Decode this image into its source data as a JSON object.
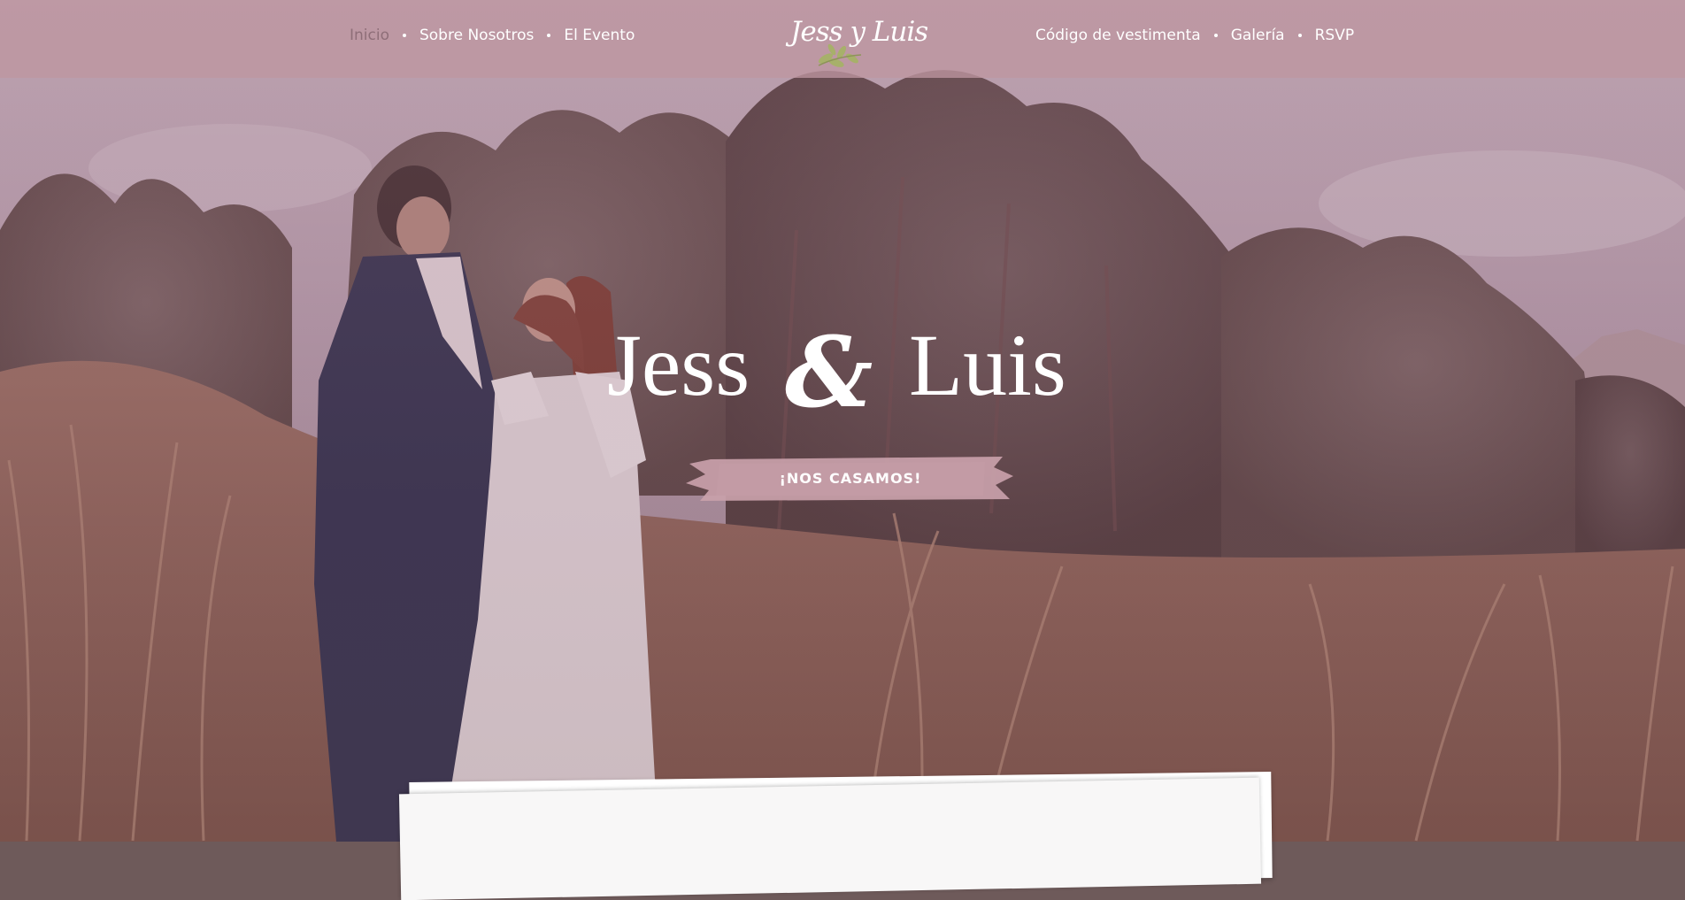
{
  "nav": {
    "left": [
      {
        "label": "Inicio",
        "active": true
      },
      {
        "label": "Sobre Nosotros",
        "active": false
      },
      {
        "label": "El Evento",
        "active": false
      }
    ],
    "right": [
      {
        "label": "Código de vestimenta",
        "active": false
      },
      {
        "label": "Galería",
        "active": false
      },
      {
        "label": "RSVP",
        "active": false
      }
    ]
  },
  "logo": {
    "text": "Jess y Luis",
    "icon": "leaf-sprig-icon"
  },
  "hero": {
    "name_1": "Jess",
    "ampersand": "&",
    "name_2": "Luis",
    "tagline": "¡NOS CASAMOS!"
  },
  "colors": {
    "nav_bg": "#be96a0",
    "nav_active": "#8e6e78",
    "ribbon": "#c9a1aa",
    "text_light": "#ffffff"
  }
}
